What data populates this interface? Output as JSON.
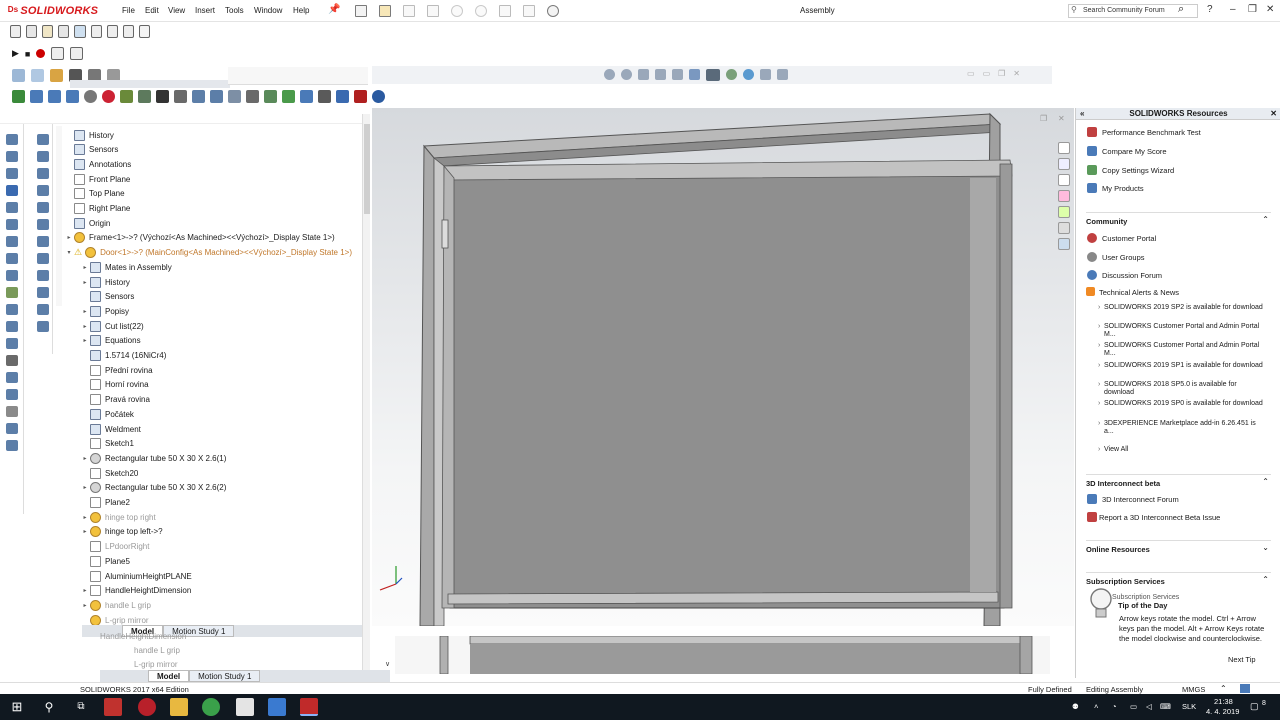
{
  "app": {
    "brand": "SOLIDWORKS",
    "document_title": "Assembly",
    "menu": [
      "File",
      "Edit",
      "View",
      "Insert",
      "Tools",
      "Window",
      "Help"
    ],
    "search_placeholder": "Search Community Forum",
    "window_controls": [
      "?",
      "–",
      "❐",
      "✕"
    ]
  },
  "tree": {
    "items": [
      {
        "label": "History",
        "indent": 0,
        "icon": "history-icon",
        "expand": ""
      },
      {
        "label": "Sensors",
        "indent": 0,
        "icon": "sensors-icon",
        "expand": ""
      },
      {
        "label": "Annotations",
        "indent": 0,
        "icon": "annotations-icon",
        "expand": ""
      },
      {
        "label": "Front Plane",
        "indent": 0,
        "icon": "plane-icon",
        "expand": ""
      },
      {
        "label": "Top Plane",
        "indent": 0,
        "icon": "plane-icon",
        "expand": ""
      },
      {
        "label": "Right Plane",
        "indent": 0,
        "icon": "plane-icon",
        "expand": ""
      },
      {
        "label": "Origin",
        "indent": 0,
        "icon": "origin-icon",
        "expand": ""
      },
      {
        "label": "Frame<1>->? (Výchozí<As Machined><<Výchozí>_Display State 1>)",
        "indent": 0,
        "icon": "part-icon",
        "expand": "▸"
      },
      {
        "label": "Door<1>->? (MainConfig<As Machined><<Výchozí>_Display State 1>)",
        "indent": 0,
        "icon": "part-icon",
        "expand": "▾",
        "warn": true,
        "orange": true
      },
      {
        "label": "Mates in Assembly",
        "indent": 1,
        "icon": "mates-icon",
        "expand": "▸"
      },
      {
        "label": "History",
        "indent": 1,
        "icon": "history-icon",
        "expand": "▸"
      },
      {
        "label": "Sensors",
        "indent": 1,
        "icon": "sensors-icon",
        "expand": ""
      },
      {
        "label": "Popisy",
        "indent": 1,
        "icon": "annotations-icon",
        "expand": "▸"
      },
      {
        "label": "Cut list(22)",
        "indent": 1,
        "icon": "cutlist-icon",
        "expand": "▸"
      },
      {
        "label": "Equations",
        "indent": 1,
        "icon": "equations-icon",
        "expand": "▸"
      },
      {
        "label": "1.5714 (16NiCr4)",
        "indent": 1,
        "icon": "material-icon",
        "expand": ""
      },
      {
        "label": "Přední rovina",
        "indent": 1,
        "icon": "plane-icon",
        "expand": ""
      },
      {
        "label": "Horní rovina",
        "indent": 1,
        "icon": "plane-icon",
        "expand": ""
      },
      {
        "label": "Pravá rovina",
        "indent": 1,
        "icon": "plane-icon",
        "expand": ""
      },
      {
        "label": "Počátek",
        "indent": 1,
        "icon": "origin-icon",
        "expand": ""
      },
      {
        "label": "Weldment",
        "indent": 1,
        "icon": "weldment-icon",
        "expand": ""
      },
      {
        "label": "Sketch1",
        "indent": 1,
        "icon": "sketch-icon",
        "expand": ""
      },
      {
        "label": "Rectangular tube 50 X 30 X 2.6(1)",
        "indent": 1,
        "icon": "structural-member-icon",
        "expand": "▸"
      },
      {
        "label": "Sketch20",
        "indent": 1,
        "icon": "sketch-icon",
        "expand": ""
      },
      {
        "label": "Rectangular tube 50 X 30 X 2.6(2)",
        "indent": 1,
        "icon": "structural-member-icon",
        "expand": "▸"
      },
      {
        "label": "Plane2",
        "indent": 1,
        "icon": "plane-icon",
        "expand": ""
      },
      {
        "label": "hinge top right",
        "indent": 1,
        "icon": "part-icon",
        "expand": "▸",
        "greyed": true
      },
      {
        "label": "hinge top left->?",
        "indent": 1,
        "icon": "part-icon",
        "expand": "▸"
      },
      {
        "label": "LPdoorRight",
        "indent": 1,
        "icon": "plane-icon",
        "expand": "",
        "greyed": true
      },
      {
        "label": "Plane5",
        "indent": 1,
        "icon": "plane-icon",
        "expand": ""
      },
      {
        "label": "AluminiumHeightPLANE",
        "indent": 1,
        "icon": "plane-icon",
        "expand": ""
      },
      {
        "label": "HandleHeightDimension",
        "indent": 1,
        "icon": "sketch-icon",
        "expand": "▸"
      },
      {
        "label": "handle L grip",
        "indent": 1,
        "icon": "part-icon",
        "expand": "▸",
        "greyed": true
      },
      {
        "label": "L-grip mirror",
        "indent": 1,
        "icon": "part-icon",
        "expand": "",
        "greyed": true
      }
    ],
    "tabs": [
      "Model",
      "Motion Study 1"
    ],
    "ghost_items": [
      "HandleHeightDimension",
      "handle L grip",
      "L-grip mirror"
    ]
  },
  "taskpane": {
    "title": "SOLIDWORKS Resources",
    "top_links": [
      "Performance Benchmark Test",
      "Compare My Score",
      "Copy Settings Wizard",
      "My Products"
    ],
    "community": {
      "title": "Community",
      "links": [
        "Customer Portal",
        "User Groups",
        "Discussion Forum",
        "Technical Alerts & News"
      ],
      "news": [
        "SOLIDWORKS 2019 SP2 is available for download",
        "SOLIDWORKS Customer Portal and Admin Portal M...",
        "SOLIDWORKS Customer Portal and Admin Portal M...",
        "SOLIDWORKS 2019 SP1 is available for download",
        "SOLIDWORKS 2018 SP5.0 is available for download",
        "SOLIDWORKS 2019 SP0 is available for download",
        "3DEXPERIENCE Marketplace add-in 6.26.451 is a..."
      ],
      "view_all": "View All"
    },
    "interconnect": {
      "title": "3D Interconnect beta",
      "links": [
        "3D Interconnect Forum",
        "Report a 3D Interconnect Beta Issue"
      ]
    },
    "online_resources": "Online Resources",
    "subscription": {
      "title": "Subscription Services",
      "overlap_text": "Subscription Services"
    },
    "tip": {
      "title": "Tip of the Day",
      "text": "Arrow keys rotate the model. Ctrl + Arrow keys pan the model. Alt + Arrow Keys rotate the model clockwise and counterclockwise.",
      "next": "Next Tip"
    }
  },
  "status": {
    "edition": "SOLIDWORKS 2017 x64 Edition",
    "fully_defined": "Fully Defined",
    "mode": "Editing Assembly",
    "units": "MMGS"
  },
  "taskbar": {
    "lang": "SLK",
    "time": "21:38",
    "date": "4. 4. 2019",
    "notification_count": "8"
  }
}
